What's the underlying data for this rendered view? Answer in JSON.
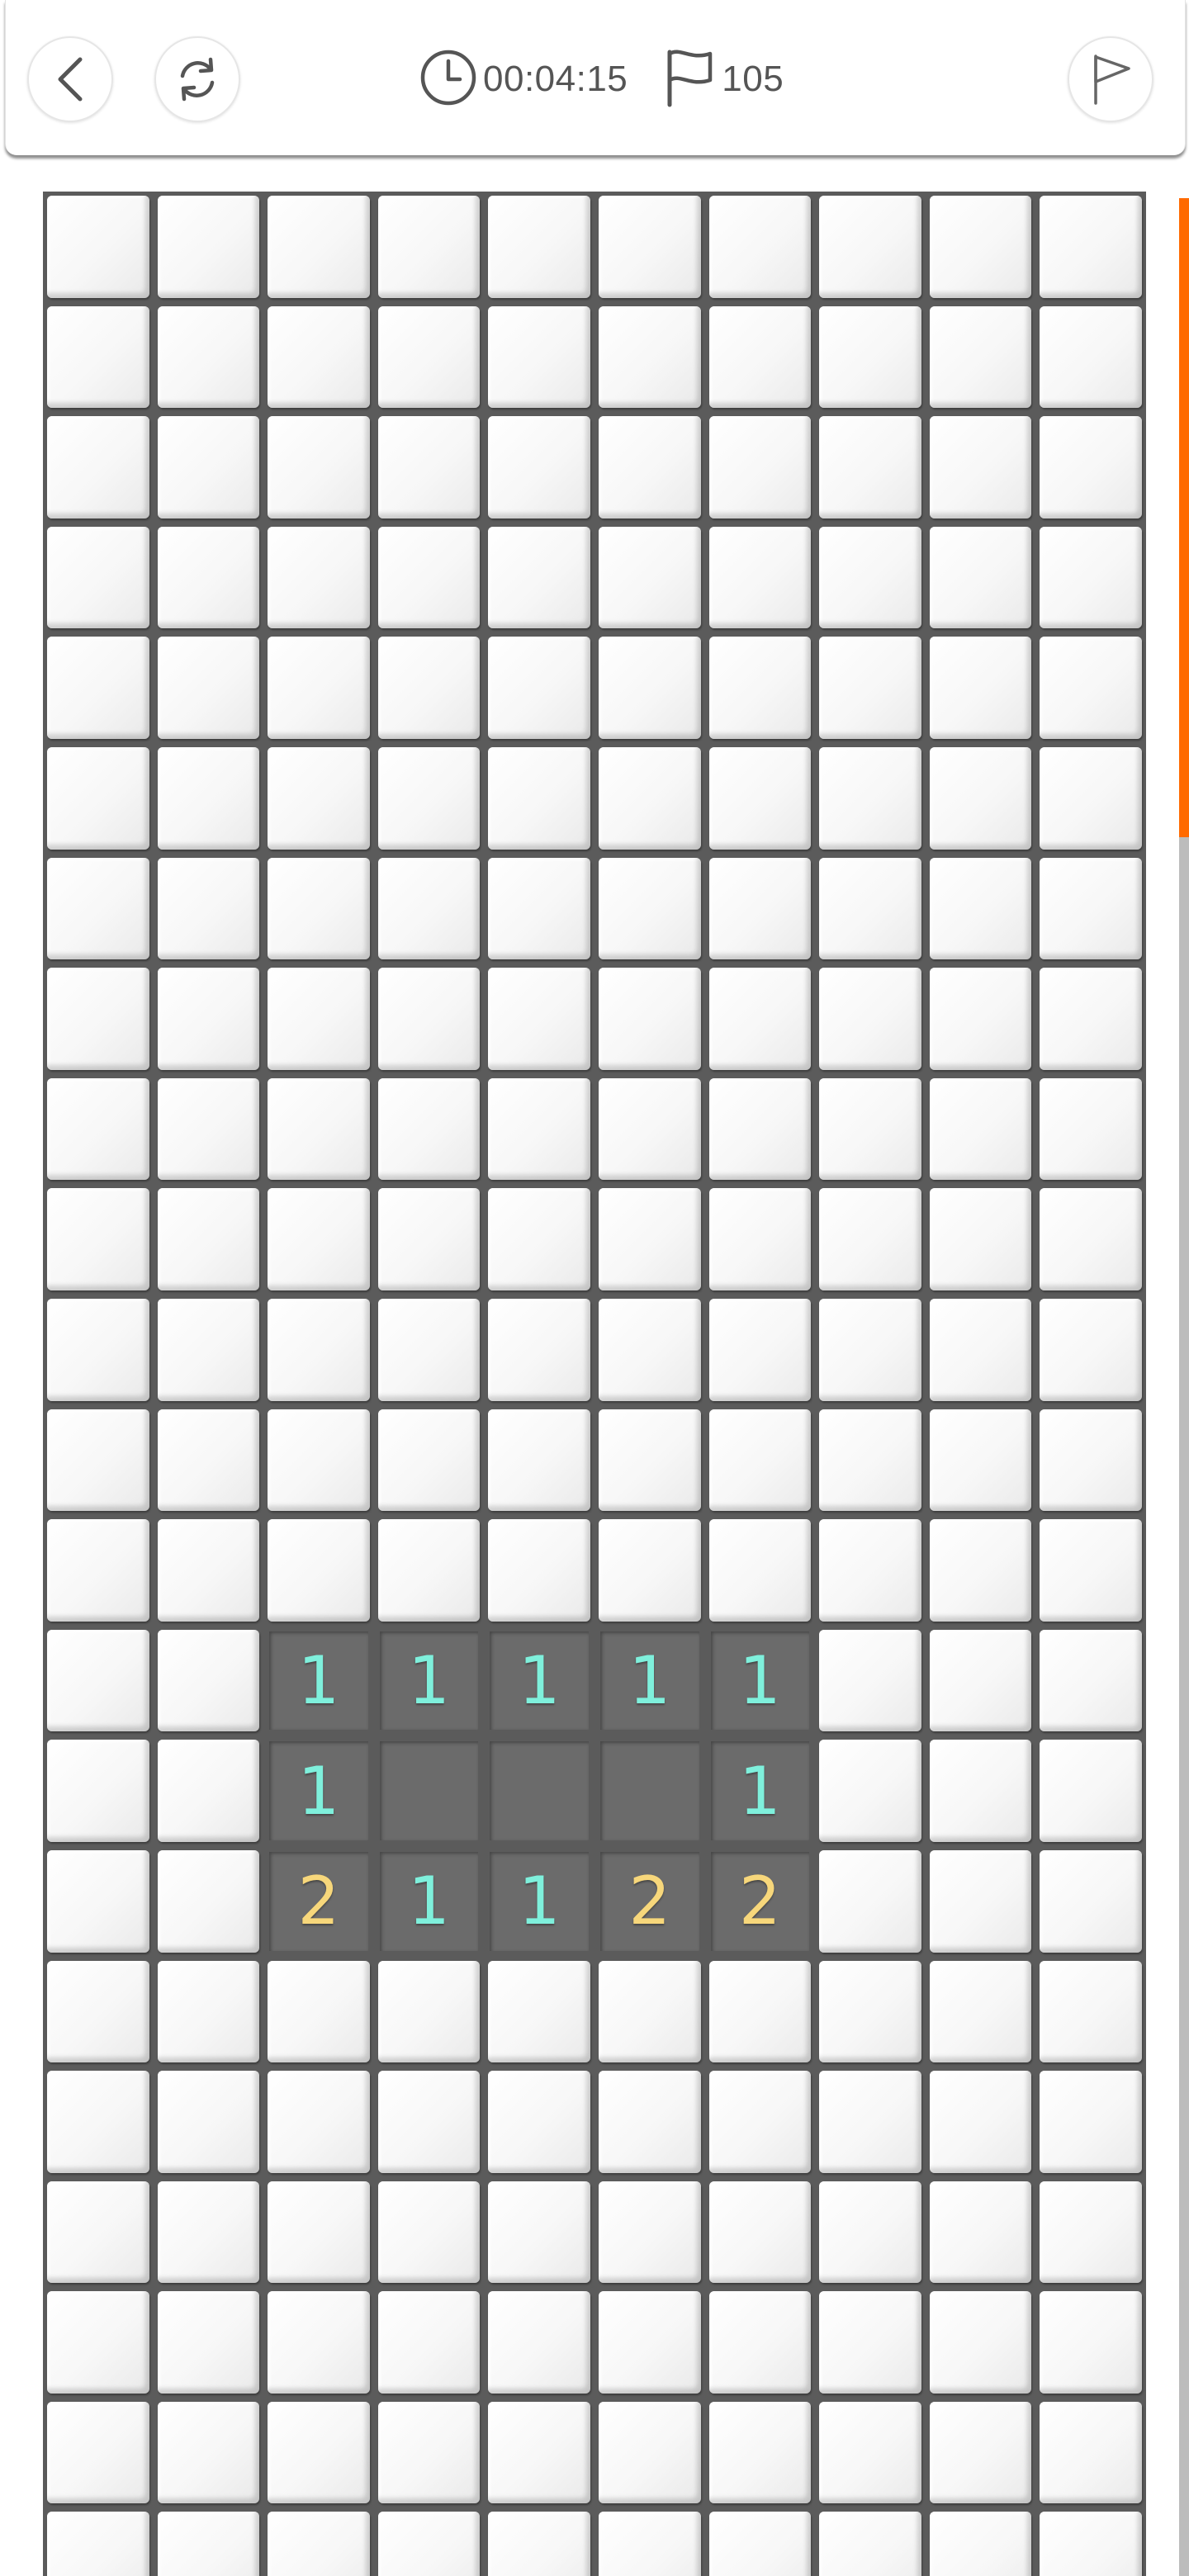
{
  "header": {
    "timer": "00:04:15",
    "flags_remaining": "105",
    "icons": {
      "back": "chevron-left-icon",
      "restart": "refresh-icon",
      "timer": "clock-icon",
      "flags": "flag-icon",
      "flag_mode": "flag-outline-icon"
    }
  },
  "board": {
    "columns": 10,
    "visible_rows": 22,
    "revealed": [
      {
        "row": 13,
        "col": 2,
        "value": "1"
      },
      {
        "row": 13,
        "col": 3,
        "value": "1"
      },
      {
        "row": 13,
        "col": 4,
        "value": "1"
      },
      {
        "row": 13,
        "col": 5,
        "value": "1"
      },
      {
        "row": 13,
        "col": 6,
        "value": "1"
      },
      {
        "row": 14,
        "col": 2,
        "value": "1"
      },
      {
        "row": 14,
        "col": 3,
        "value": ""
      },
      {
        "row": 14,
        "col": 4,
        "value": ""
      },
      {
        "row": 14,
        "col": 5,
        "value": ""
      },
      {
        "row": 14,
        "col": 6,
        "value": "1"
      },
      {
        "row": 15,
        "col": 2,
        "value": "2"
      },
      {
        "row": 15,
        "col": 3,
        "value": "1"
      },
      {
        "row": 15,
        "col": 4,
        "value": "1"
      },
      {
        "row": 15,
        "col": 5,
        "value": "2"
      },
      {
        "row": 15,
        "col": 6,
        "value": "2"
      }
    ]
  },
  "colors": {
    "number_1": "#7ff0dc",
    "number_2": "#f7d77b",
    "scroll_thumb": "#ff6a00",
    "scroll_track": "#bcbcbc",
    "board_background": "#5b5b5b"
  },
  "scrollbar": {
    "position": 0,
    "visible_fraction": 0.048
  }
}
